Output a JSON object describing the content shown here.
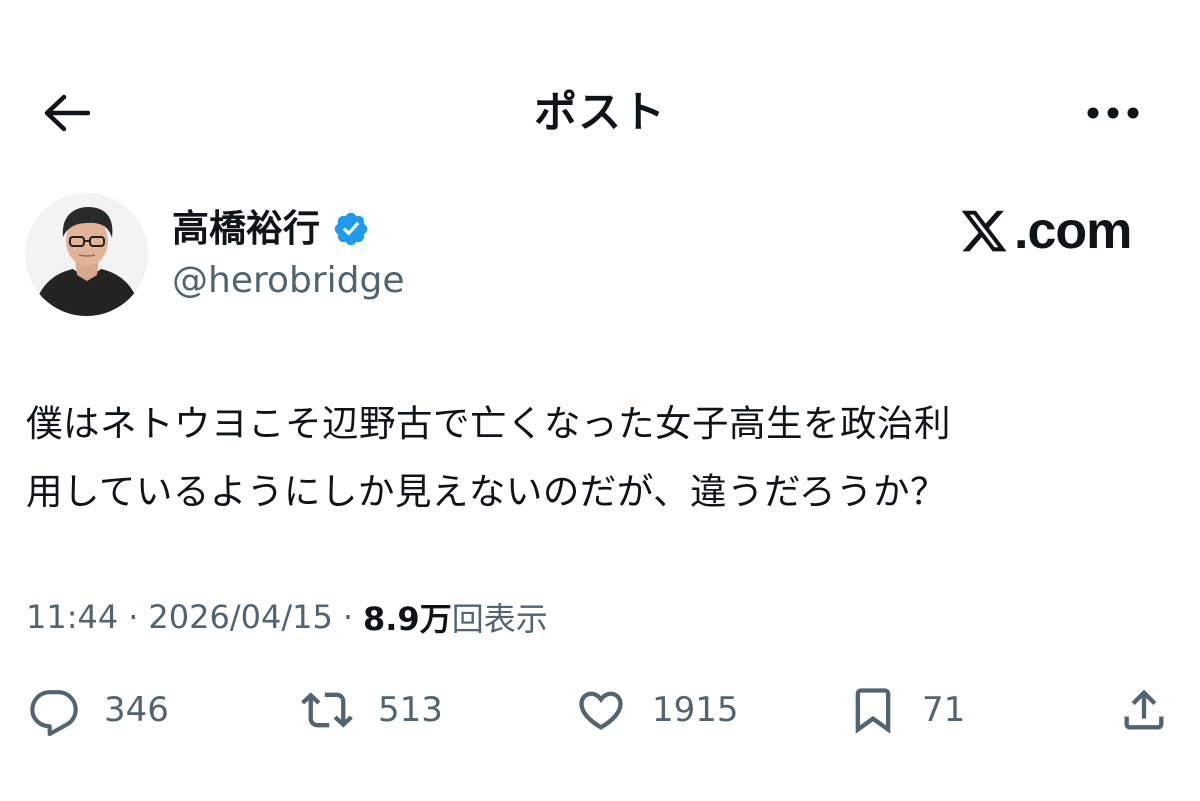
{
  "header": {
    "title": "ポスト",
    "back_icon": "arrow-left-icon",
    "more_icon": "more-horizontal-icon"
  },
  "author": {
    "display_name": "高橋裕行",
    "handle": "@herobridge",
    "verified": true,
    "verified_color": "#1d9bf0"
  },
  "branding": {
    "site": ".com",
    "logo_letter": "X"
  },
  "post": {
    "text": "僕はネトウヨこそ辺野古で亡くなった女子高生を政治利\n用しているようにしか見えないのだが、違うだろうか？"
  },
  "meta": {
    "time": "11:44",
    "separator": "·",
    "date": "2026/04/15",
    "views_count": "8.9万",
    "views_label": "回表示"
  },
  "actions": {
    "reply": {
      "icon": "reply-icon",
      "count": "346"
    },
    "repost": {
      "icon": "repost-icon",
      "count": "513"
    },
    "like": {
      "icon": "heart-icon",
      "count": "1915"
    },
    "bookmark": {
      "icon": "bookmark-icon",
      "count": "71"
    },
    "share": {
      "icon": "share-icon"
    }
  },
  "colors": {
    "text": "#0f1419",
    "secondary": "#536471",
    "accent": "#1d9bf0"
  }
}
